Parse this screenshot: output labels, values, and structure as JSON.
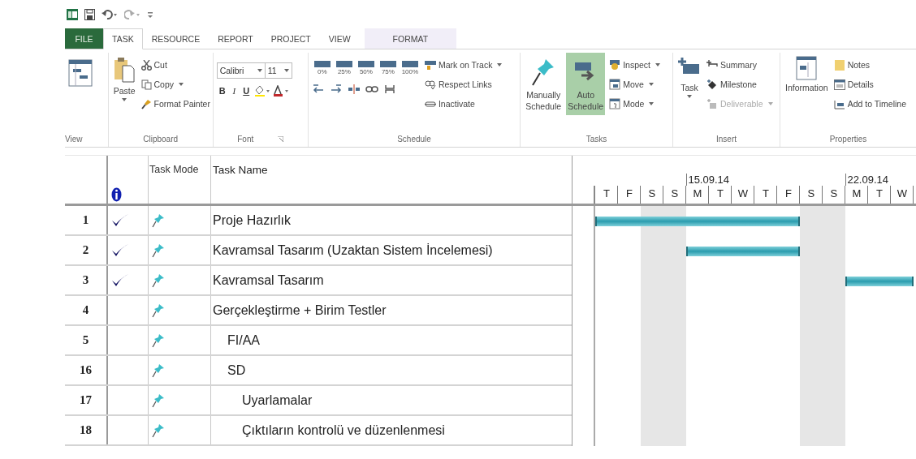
{
  "tabs": [
    {
      "label": "FILE",
      "kind": "file",
      "selected": false
    },
    {
      "label": "TASK",
      "kind": "tab",
      "selected": true
    },
    {
      "label": "RESOURCE",
      "kind": "tab",
      "selected": false
    },
    {
      "label": "REPORT",
      "kind": "tab",
      "selected": false
    },
    {
      "label": "PROJECT",
      "kind": "tab",
      "selected": false
    },
    {
      "label": "VIEW",
      "kind": "tab",
      "selected": false
    },
    {
      "label": "FORMAT",
      "kind": "contextual",
      "selected": false
    }
  ],
  "ribbon": {
    "groups": [
      {
        "kind": "view",
        "label": "View"
      },
      {
        "kind": "clipboard",
        "label": "Clipboard",
        "paste": "Paste",
        "cut": "Cut",
        "copy": "Copy",
        "format_painter": "Format Painter"
      },
      {
        "kind": "font",
        "label": "Font",
        "font": "Calibri",
        "size": "11",
        "styles": [
          "B",
          "I",
          "U"
        ]
      },
      {
        "kind": "schedule",
        "label": "Schedule",
        "percents": [
          "0%",
          "25%",
          "50%",
          "75%",
          "100%"
        ],
        "mark_on_track": "Mark on Track",
        "respect_links": "Respect Links",
        "inactivate": "Inactivate"
      },
      {
        "kind": "tasks",
        "label": "Tasks",
        "buttons": [
          {
            "label": "Manually Schedule",
            "selected": false
          },
          {
            "label": "Auto Schedule",
            "selected": true
          }
        ],
        "inspect": "Inspect",
        "move": "Move",
        "mode": "Mode"
      },
      {
        "kind": "insert",
        "label": "Insert",
        "task": "Task",
        "summary": "Summary",
        "milestone": "Milestone",
        "deliverable": {
          "label": "Deliverable",
          "disabled": true
        }
      },
      {
        "kind": "properties",
        "label": "Properties",
        "information": "Information",
        "notes": "Notes",
        "details": "Details",
        "add_to_timeline": "Add to Timeline"
      }
    ]
  },
  "table": {
    "columns": [
      "Task Mode",
      "Task Name"
    ]
  },
  "gantt": {
    "days": [
      {
        "letter": "T",
        "nonworking": false
      },
      {
        "letter": "F",
        "nonworking": false
      },
      {
        "letter": "S",
        "nonworking": true
      },
      {
        "letter": "S",
        "nonworking": true
      },
      {
        "letter": "M",
        "nonworking": false,
        "week": "15.09.14"
      },
      {
        "letter": "T",
        "nonworking": false
      },
      {
        "letter": "W",
        "nonworking": false
      },
      {
        "letter": "T",
        "nonworking": false
      },
      {
        "letter": "F",
        "nonworking": false
      },
      {
        "letter": "S",
        "nonworking": true
      },
      {
        "letter": "S",
        "nonworking": true
      },
      {
        "letter": "M",
        "nonworking": false,
        "week": "22.09.14"
      },
      {
        "letter": "T",
        "nonworking": false
      },
      {
        "letter": "W",
        "nonworking": false
      }
    ]
  },
  "tasks": [
    {
      "id": "1",
      "done": true,
      "name": "Proje Hazırlık",
      "bar_days": [
        true,
        true,
        true,
        true,
        true,
        true,
        true,
        true,
        true,
        false,
        false,
        false,
        false,
        false
      ]
    },
    {
      "id": "2",
      "done": true,
      "name": "Kavramsal Tasarım (Uzaktan Sistem İncelemesi)",
      "bar_days": [
        false,
        false,
        false,
        false,
        true,
        true,
        true,
        true,
        true,
        false,
        false,
        false,
        false,
        false
      ]
    },
    {
      "id": "3",
      "done": true,
      "name": "Kavramsal Tasarım",
      "bar_days": [
        false,
        false,
        false,
        false,
        false,
        false,
        false,
        false,
        false,
        false,
        false,
        true,
        true,
        true
      ]
    },
    {
      "id": "4",
      "done": false,
      "name": "Gerçekleştirme + Birim Testler",
      "children": [
        {
          "id": "5",
          "done": false,
          "name": "FI/AA"
        },
        {
          "id": "16",
          "done": false,
          "name": "SD",
          "children": [
            {
              "id": "17",
              "done": false,
              "name": "Uyarlamalar"
            },
            {
              "id": "18",
              "done": false,
              "name": "Çıktıların kontrolü ve düzenlenmesi"
            }
          ]
        }
      ]
    }
  ]
}
